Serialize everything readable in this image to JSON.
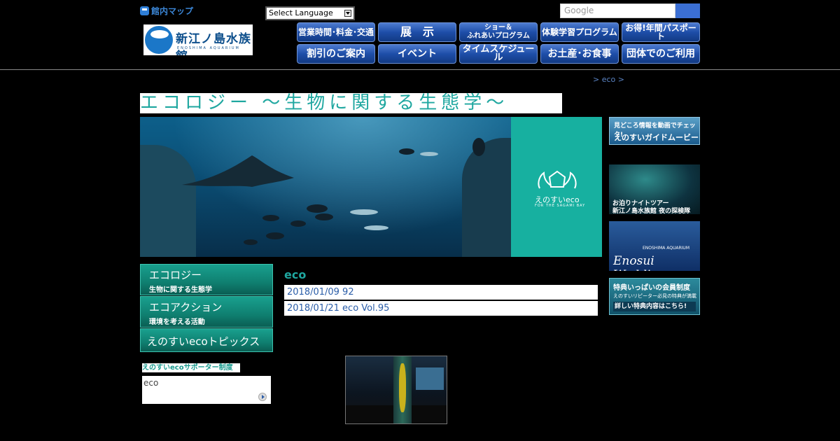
{
  "header": {
    "map_link": "館内マップ",
    "language_select": "Select Language",
    "search_placeholder": "Google",
    "logo_text": "新江ノ島水族館",
    "logo_sub": "ENOSHIMA AQUARIUM"
  },
  "nav": {
    "row1": [
      {
        "label": "営業時間･料金･交通"
      },
      {
        "label": "展　示"
      },
      {
        "label": "ショー＆",
        "label2": "ふれあいプログラム"
      },
      {
        "label": "体験学習プログラム"
      },
      {
        "label": "お得!年間パスポート"
      }
    ],
    "row2": [
      {
        "label": "割引のご案内"
      },
      {
        "label": "イベント"
      },
      {
        "label": "タイムスケジュール"
      },
      {
        "label": "お土産･お食事"
      },
      {
        "label": "団体でのご利用"
      }
    ]
  },
  "breadcrumb": "> eco >",
  "page_title": "エコロジー ～生物に関する生態学～",
  "hero": {
    "brand": "えのすいeco",
    "tagline": "FOR THE SAGAMI BAY"
  },
  "side_banners": {
    "guide": {
      "line1": "見どころ情報を動画でチェック!",
      "line2": "えのすいガイドムービー"
    },
    "night": {
      "line1": "お泊りナイトツアー",
      "line2": "新江ノ島水族館 夜の探検隊"
    },
    "wedding": {
      "line1": "ENOSHIMA AQUARIUM",
      "line2": "Enosui Wedding"
    },
    "member": {
      "line1": "特典いっぱいの会員制度",
      "line2": "えのすいリピーター必見の特典が満載",
      "line3": "詳しい特典内容はこちら!"
    }
  },
  "side_menu": [
    {
      "main": "エコロジー",
      "sub": "生物に関する生態学"
    },
    {
      "main": "エコアクション",
      "sub": "環境を考える活動"
    },
    {
      "main": "えのすいecoトピックス",
      "sub": ""
    }
  ],
  "supporter": {
    "label": "えのすいecoサポーター制度",
    "text": "eco"
  },
  "main": {
    "section_title": "eco",
    "news": [
      {
        "text": "2018/01/09  92"
      },
      {
        "text": "2018/01/21 eco Vol.95"
      }
    ]
  },
  "colors": {
    "accent_teal": "#1fa7a0",
    "nav_blue": "#1e4ea8",
    "link_blue": "#2a5da8"
  }
}
